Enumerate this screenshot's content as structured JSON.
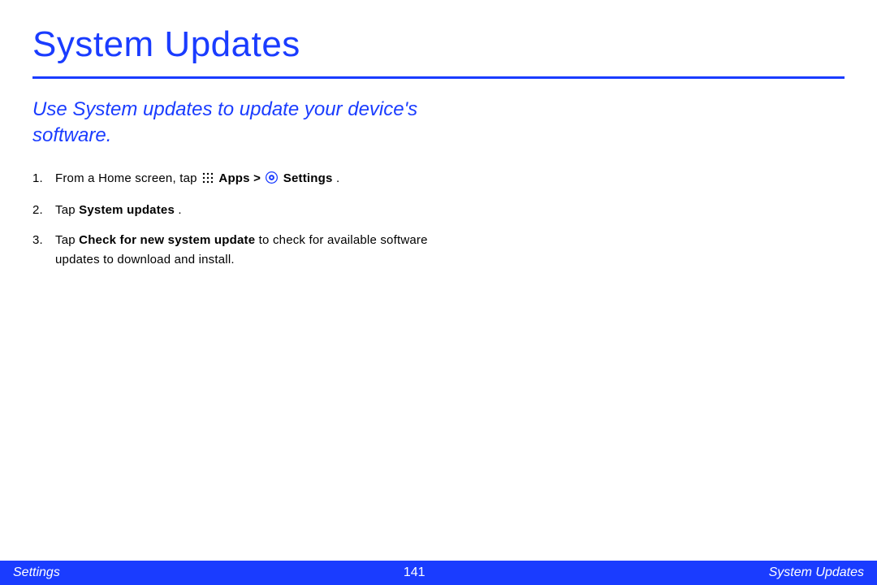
{
  "title": "System Updates",
  "subtitle": "Use System updates to update your device's software.",
  "steps": {
    "s1_pre": "From a Home screen, tap ",
    "s1_apps": "Apps",
    "s1_gt": " > ",
    "s1_settings": "Settings",
    "s1_post": ".",
    "s2_pre": "Tap ",
    "s2_bold": "System updates",
    "s2_post": ".",
    "s3_pre": "Tap ",
    "s3_bold": "Check for new system update",
    "s3_post": " to check for available software updates to download and install."
  },
  "footer": {
    "left": "Settings",
    "center": "141",
    "right": "System Updates"
  }
}
